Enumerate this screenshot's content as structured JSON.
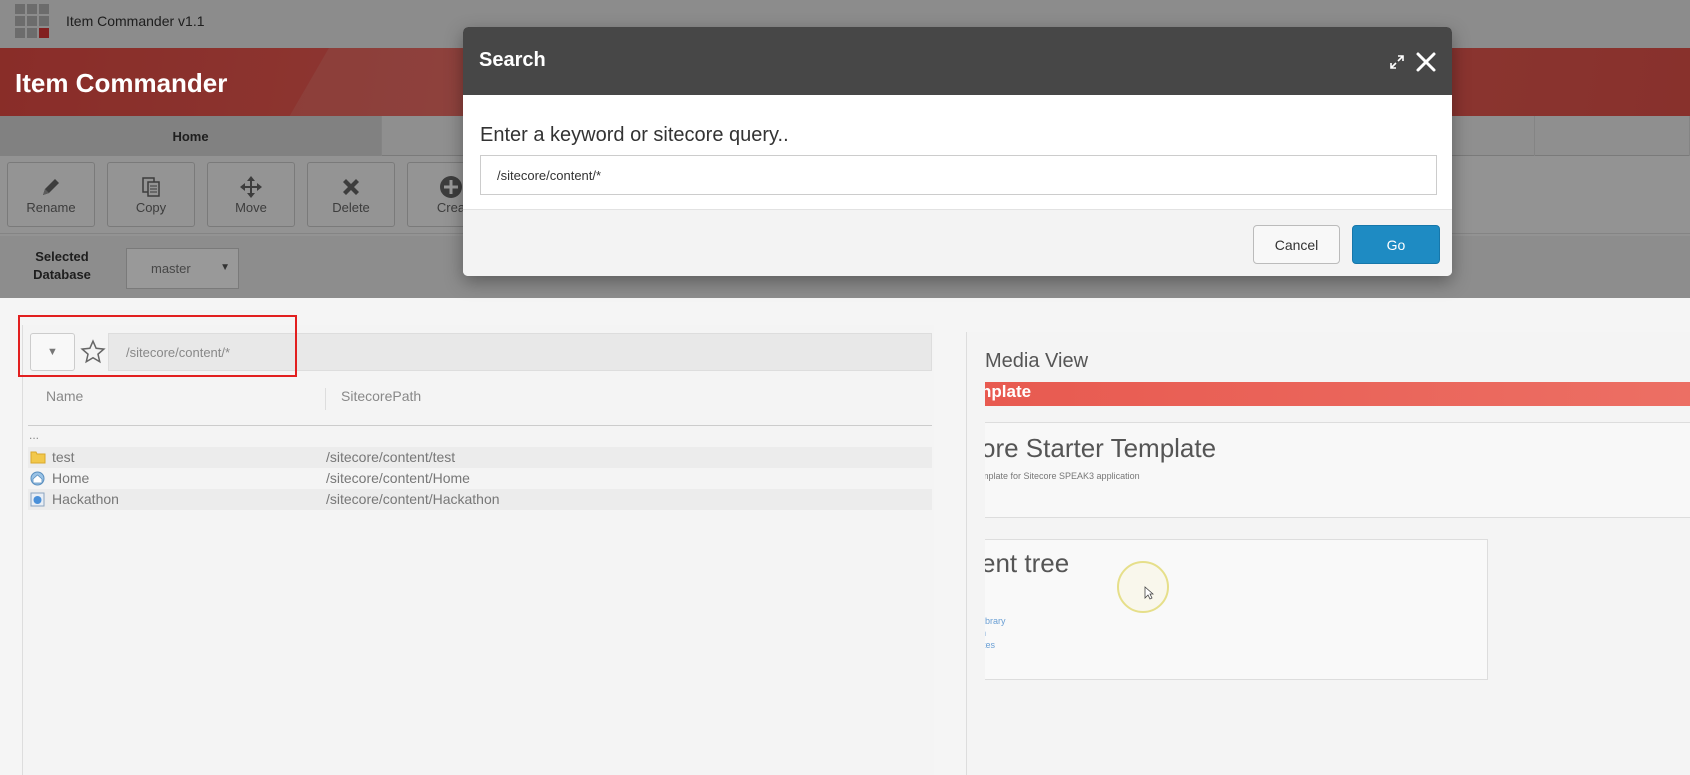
{
  "app": {
    "title": "Item Commander v1.1",
    "banner_title": "Item Commander"
  },
  "tabs": [
    {
      "label": "Home",
      "active": true
    }
  ],
  "toolbar": {
    "buttons": [
      {
        "label": "Rename",
        "icon": "pencil-icon"
      },
      {
        "label": "Copy",
        "icon": "copy-icon"
      },
      {
        "label": "Move",
        "icon": "move-icon"
      },
      {
        "label": "Delete",
        "icon": "delete-x-icon"
      },
      {
        "label": "Crea",
        "icon": "plus-circle-icon"
      }
    ]
  },
  "database": {
    "label_line1": "Selected",
    "label_line2": "Database",
    "selected": "master"
  },
  "search_bar": {
    "path_value": "/sitecore/content/*"
  },
  "table": {
    "columns": [
      "Name",
      "SitecorePath"
    ],
    "parent_row": "...",
    "rows": [
      {
        "name": "test",
        "path": "/sitecore/content/test",
        "icon": "folder-icon"
      },
      {
        "name": "Home",
        "path": "/sitecore/content/Home",
        "icon": "home-globe-icon"
      },
      {
        "name": "Hackathon",
        "path": "/sitecore/content/Hackathon",
        "icon": "page-globe-icon"
      }
    ]
  },
  "media_view": {
    "title": "Media View",
    "banner_text": "nplate",
    "heading": "ore Starter Template",
    "subheading": "mplate for Sitecore SPEAK3 application",
    "card_heading": "ent tree",
    "card_star": "*",
    "links": [
      "library",
      "n",
      "ites"
    ]
  },
  "modal": {
    "title": "Search",
    "prompt": "Enter a keyword or sitecore query..",
    "query_value": "/sitecore/content/*",
    "cancel_label": "Cancel",
    "go_label": "Go"
  },
  "colors": {
    "accent_red": "#e54b44",
    "go_blue": "#1e8bc3",
    "modal_header": "#474747",
    "highlight_box": "#e21f1f"
  }
}
